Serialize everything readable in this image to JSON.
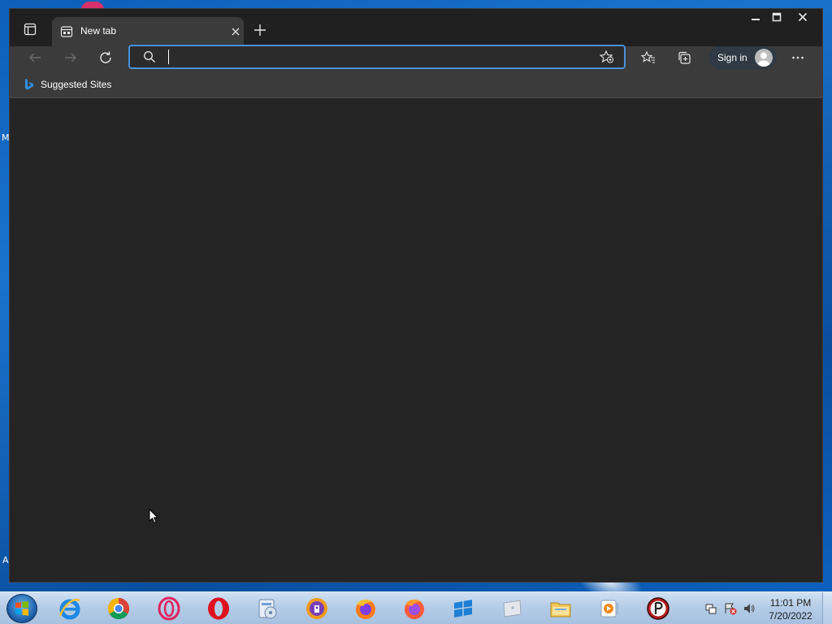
{
  "browser": {
    "tab": {
      "title": "New tab"
    },
    "address": {
      "value": "",
      "placeholder": ""
    },
    "signin_label": "Sign in",
    "favorites_bar": {
      "items": [
        {
          "label": "Suggested Sites",
          "icon": "bing-icon"
        }
      ]
    },
    "toolbar_icons": [
      "back-icon",
      "forward-icon",
      "refresh-icon",
      "search-icon",
      "add-favorite-icon",
      "favorites-icon",
      "collections-icon",
      "avatar-icon",
      "more-icon"
    ],
    "caption_icons": [
      "minimize-icon",
      "maximize-icon",
      "close-icon"
    ]
  },
  "taskbar": {
    "apps": [
      "internet-explorer-icon",
      "chrome-icon",
      "opera-gx-icon",
      "opera-icon",
      "utility-app-icon",
      "vpn-app-icon",
      "firefox-icon",
      "firefox-nightly-icon",
      "windows-app-icon",
      "blank-app-icon",
      "file-explorer-icon",
      "media-player-icon",
      "pasteapp-icon"
    ],
    "clock": {
      "time": "11:01 PM",
      "date": "7/20/2022"
    }
  },
  "colors": {
    "accent": "#4a90d9",
    "window_bg": "#202020",
    "toolbar_bg": "#3b3b3b",
    "content_bg": "#242424"
  }
}
